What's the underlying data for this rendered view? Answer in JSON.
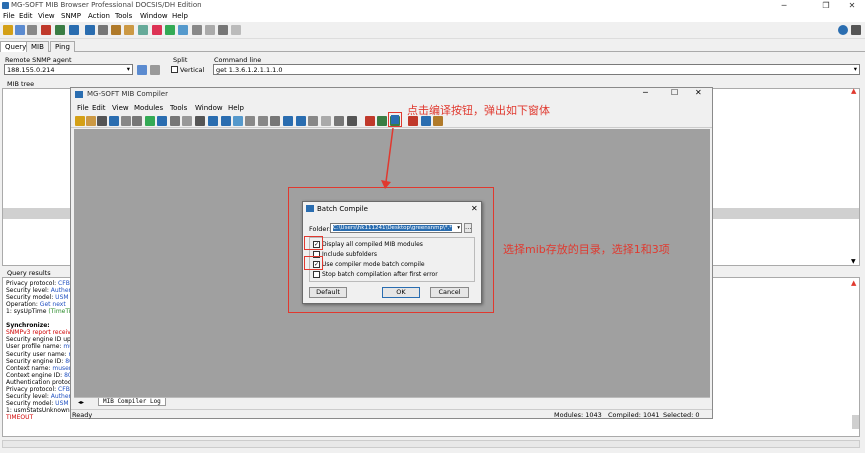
{
  "main": {
    "title": "MG-SOFT MIB Browser Professional DOCSIS/DH Edition",
    "menu": [
      "File",
      "Edit",
      "View",
      "SNMP",
      "Action",
      "Tools",
      "Window",
      "Help"
    ],
    "tabs": [
      "Query",
      "MIB",
      "Ping"
    ],
    "agent_label": "Remote SNMP agent",
    "agent_value": "188.155.0.214",
    "split_label": "Split",
    "vertical_label": "Vertical",
    "command_label": "Command line",
    "command_value": "get 1.3.6.1.2.1.1.1.0",
    "mib_tree_label": "MIB tree",
    "query_results_label": "Query results"
  },
  "results": [
    {
      "k": "Privacy protocol: ",
      "v": "CFB AES",
      "c": "blue"
    },
    {
      "k": "Security level: ",
      "v": "Authenticat",
      "c": "blue"
    },
    {
      "k": "Security model: ",
      "v": "USM",
      "c": "blue"
    },
    {
      "k": "Operation: ",
      "v": "Get next",
      "c": "blue"
    },
    {
      "k": "1: sysUpTime ",
      "v": "(TimeTicks)",
      "c": "green"
    },
    {
      "k": "",
      "v": "",
      "c": ""
    },
    {
      "k": "Synchronize:",
      "v": "",
      "c": "bold"
    },
    {
      "k": "SNMPv3 report received f",
      "v": "",
      "c": "red"
    },
    {
      "k": "Security engine ID update",
      "v": "",
      "c": "blue"
    },
    {
      "k": "User profile name: ",
      "v": "muser",
      "c": "blue"
    },
    {
      "k": "Security user name: ",
      "v": "muser",
      "c": "blue"
    },
    {
      "k": "Security engine ID: ",
      "v": "80.00.",
      "c": "blue"
    },
    {
      "k": "Context name: ",
      "v": "muser",
      "c": "blue"
    },
    {
      "k": "Context engine ID: ",
      "v": "80.00.4",
      "c": "blue"
    },
    {
      "k": "Authentication protocol: ",
      "v": "H",
      "c": "blue"
    },
    {
      "k": "Privacy protocol: ",
      "v": "CFB AES",
      "c": "blue"
    },
    {
      "k": "Security level: ",
      "v": "Authenticati",
      "c": "blue"
    },
    {
      "k": "Security model: ",
      "v": "USM",
      "c": "blue"
    },
    {
      "k": "1: usmStatsUnknownEngin",
      "v": "",
      "c": ""
    },
    {
      "k": "TIMEOUT",
      "v": "",
      "c": "red"
    }
  ],
  "compiler": {
    "title": "MG-SOFT MIB Compiler",
    "menu": [
      "File",
      "Edit",
      "View",
      "Modules",
      "Tools",
      "Window",
      "Help"
    ],
    "tab_label": "MIB Compiler Log",
    "status_ready": "Ready",
    "status_modules": "Modules: 1043",
    "status_compiled": "Compiled: 1041",
    "status_selected": "Selected: 0"
  },
  "dialog": {
    "title": "Batch Compile",
    "folder_label": "Folder:",
    "folder_value": "C:\\Users\\hk111241\\Desktop\\greensnmp\\*.*",
    "options": [
      {
        "label": "Display all compiled MIB modules",
        "checked": true
      },
      {
        "label": "Include subfolders",
        "checked": false
      },
      {
        "label": "Use compiler mode batch compile",
        "checked": true
      },
      {
        "label": "Stop batch compilation after first error",
        "checked": false
      }
    ],
    "default_btn": "Default",
    "ok_btn": "OK",
    "cancel_btn": "Cancel"
  },
  "annotations": {
    "top": "点击编译按钮，弹出如下窗体",
    "right": "选择mib存放的目录，选择1和3项"
  }
}
